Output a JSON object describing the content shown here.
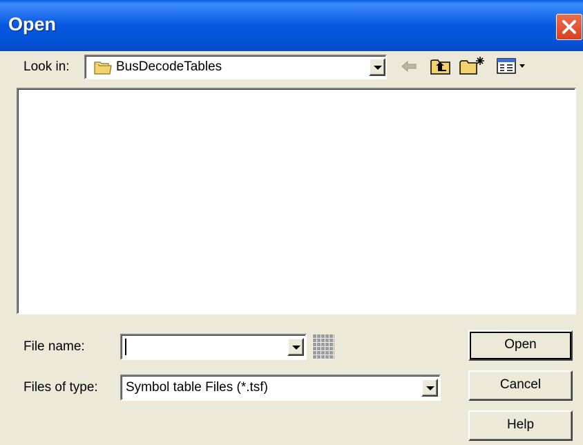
{
  "window": {
    "title": "Open"
  },
  "lookin": {
    "label": "Look in:",
    "value": "BusDecodeTables"
  },
  "toolbar": {
    "icons": [
      "back-arrow-icon",
      "up-folder-icon",
      "new-folder-icon",
      "view-menu-icon"
    ]
  },
  "filename": {
    "label": "File name:",
    "value": ""
  },
  "filetype": {
    "label": "Files of type:",
    "value": "Symbol table Files (*.tsf)"
  },
  "buttons": {
    "open": "Open",
    "cancel": "Cancel",
    "help": "Help"
  },
  "colors": {
    "titlebar": "#0a5ee4",
    "close": "#e06040",
    "dialog_bg": "#ece9d8"
  }
}
